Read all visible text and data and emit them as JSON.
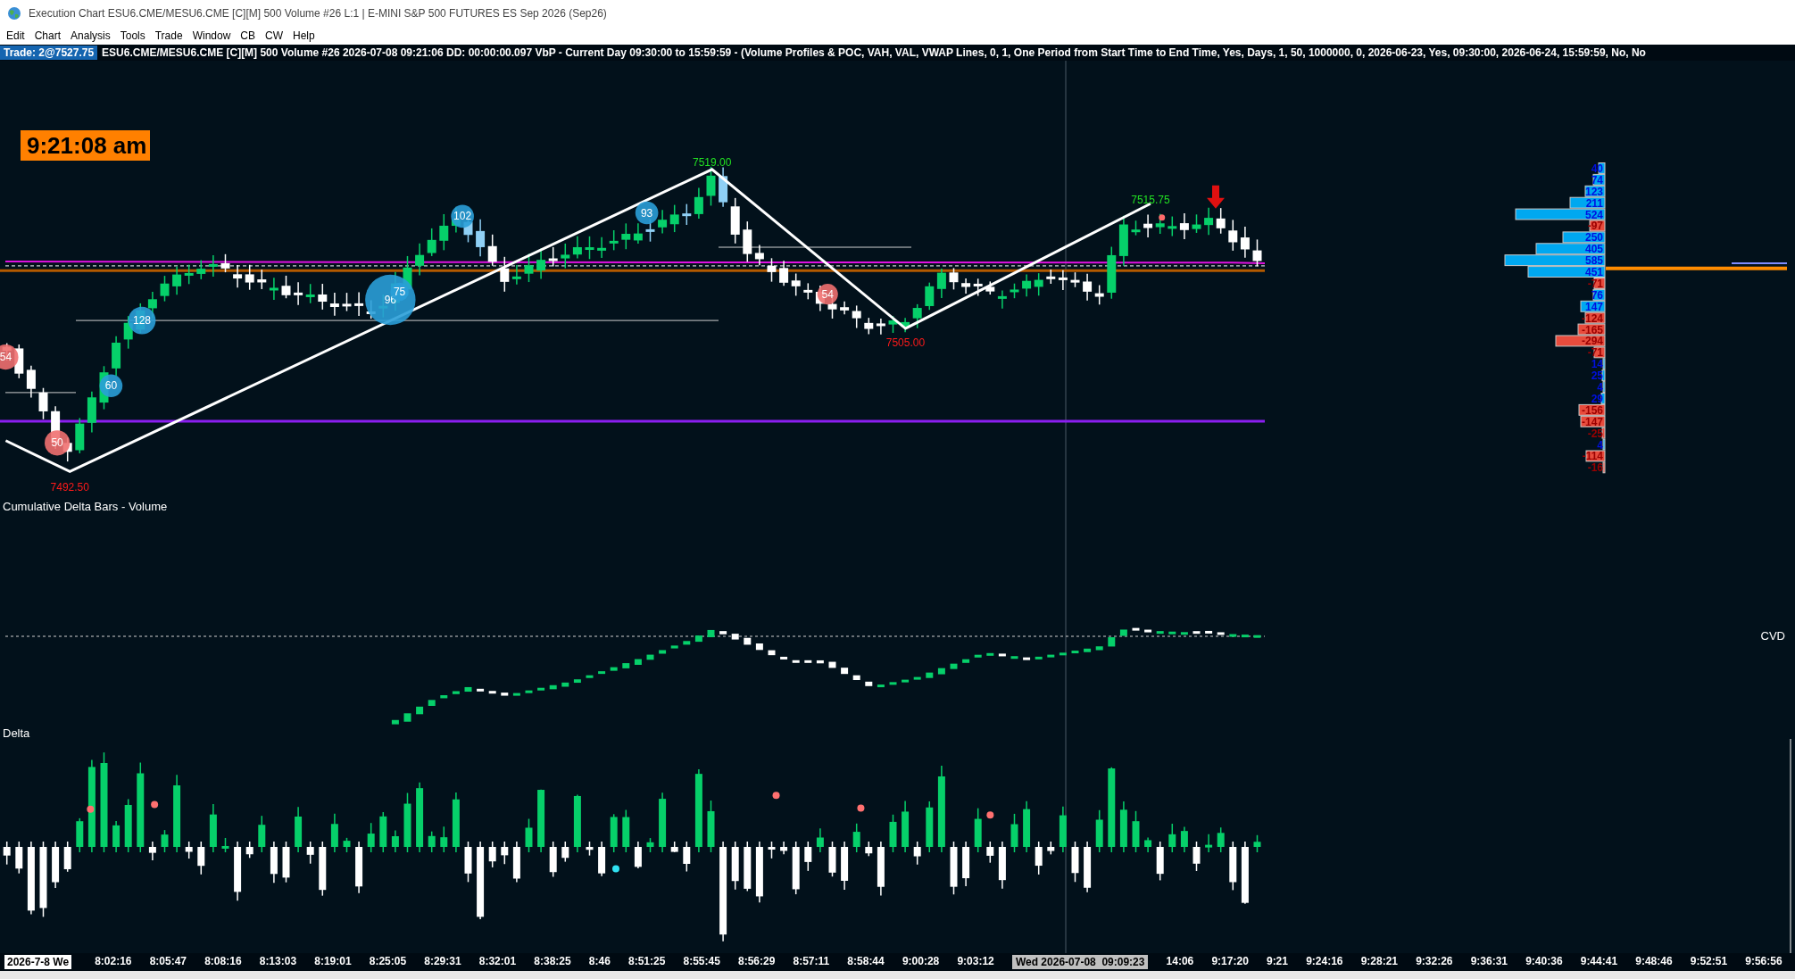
{
  "window": {
    "title": "Execution Chart ESU6.CME/MESU6.CME [C][M]  500 Volume #26 L:1 | E-MINI S&P 500 FUTURES ES Sep 2026 (Sep26)"
  },
  "menu": [
    "Edit",
    "Chart",
    "Analysis",
    "Tools",
    "Trade",
    "Window",
    "CB",
    "CW",
    "Help"
  ],
  "chart_header": {
    "trade": "Trade: 2@7527.75",
    "info": "ESU6.CME/MESU6.CME [C][M]  500 Volume #26 2026-07-08 09:21:06 DD: 00:00:00.097 VbP - Current Day 09:30:00 to 15:59:59 - (Volume Profiles & POC, VAH, VAL, VWAP Lines, 0, 1, One Period from Start Time to End Time, Yes, Days, 1, 50, 1000000, 0, 2026-06-23, Yes, 09:30:00, 2026-06-24, 15:59:59, No, No"
  },
  "clock": "9:21:08 am",
  "price_labels": [
    {
      "text": "7519.00",
      "kind": "high"
    },
    {
      "text": "7515.75",
      "kind": "high"
    },
    {
      "text": "7505.00",
      "kind": "low"
    },
    {
      "text": "7492.50",
      "kind": "low"
    }
  ],
  "bubbles": [
    {
      "text": "54",
      "kind": "sell"
    },
    {
      "text": "50",
      "kind": "sell"
    },
    {
      "text": "60",
      "kind": "buy"
    },
    {
      "text": "128",
      "kind": "buy"
    },
    {
      "text": "96",
      "kind": "buy"
    },
    {
      "text": "75",
      "kind": "buy"
    },
    {
      "text": "102",
      "kind": "buy"
    },
    {
      "text": "93",
      "kind": "buy"
    },
    {
      "text": "54",
      "kind": "sell"
    }
  ],
  "panels": [
    {
      "title": "Cumulative Delta Bars - Volume",
      "label": "CVD"
    },
    {
      "title": "Delta"
    }
  ],
  "volume_profile": [
    {
      "value": "40",
      "kind": "buy"
    },
    {
      "value": "74",
      "kind": "buy"
    },
    {
      "value": "123",
      "kind": "buy"
    },
    {
      "value": "211",
      "kind": "buy"
    },
    {
      "value": "524",
      "kind": "buy"
    },
    {
      "value": "-97",
      "kind": "sell"
    },
    {
      "value": "250",
      "kind": "buy"
    },
    {
      "value": "405",
      "kind": "buy"
    },
    {
      "value": "585",
      "kind": "buy"
    },
    {
      "value": "451",
      "kind": "buy"
    },
    {
      "value": "-71",
      "kind": "sell"
    },
    {
      "value": "76",
      "kind": "buy"
    },
    {
      "value": "147",
      "kind": "buy"
    },
    {
      "value": "-124",
      "kind": "sell"
    },
    {
      "value": "-165",
      "kind": "sell"
    },
    {
      "value": "-294",
      "kind": "sell"
    },
    {
      "value": "-71",
      "kind": "sell"
    },
    {
      "value": "14",
      "kind": "buy"
    },
    {
      "value": "25",
      "kind": "buy"
    },
    {
      "value": "4",
      "kind": "buy"
    },
    {
      "value": "29",
      "kind": "buy"
    },
    {
      "value": "-156",
      "kind": "sell"
    },
    {
      "value": "-147",
      "kind": "sell"
    },
    {
      "value": "-25",
      "kind": "sell"
    },
    {
      "value": "4",
      "kind": "buy"
    },
    {
      "value": "-114",
      "kind": "sell"
    },
    {
      "value": "-16",
      "kind": "sell"
    }
  ],
  "time_axis": {
    "date": "2026-7-8 We",
    "cursor": "Wed 2026-07-08  09:09:23",
    "labels": [
      "8:02:16",
      "8:05:47",
      "8:08:16",
      "8:13:03",
      "8:19:01",
      "8:25:05",
      "8:29:31",
      "8:32:01",
      "8:38:25",
      "8:46",
      "8:51:25",
      "8:55:45",
      "8:56:29",
      "8:57:11",
      "8:58:44",
      "9:00:28",
      "9:03:12",
      "14:06",
      "9:17:20",
      "9:21",
      "9:24:16",
      "9:28:21",
      "9:32:26",
      "9:36:31",
      "9:40:36",
      "9:44:41",
      "9:48:46",
      "9:52:51",
      "9:56:56"
    ]
  }
}
